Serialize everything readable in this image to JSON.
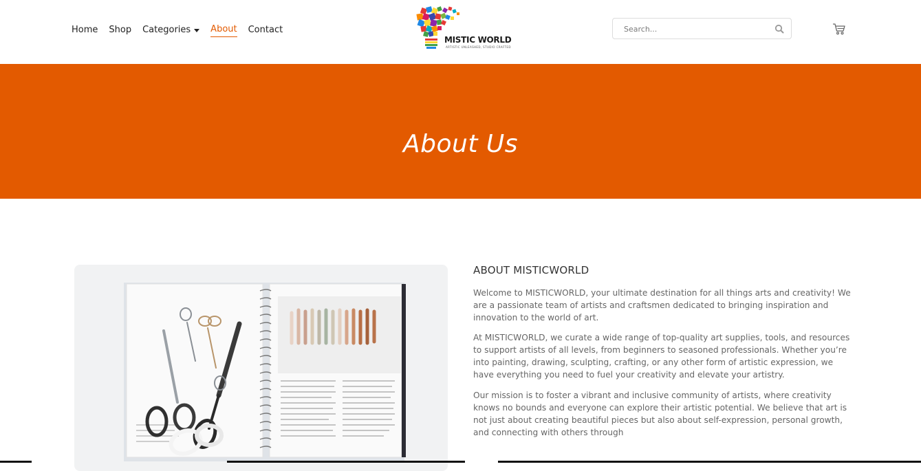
{
  "nav": {
    "items": [
      {
        "label": "Home",
        "active": false
      },
      {
        "label": "Shop",
        "active": false
      },
      {
        "label": "Categories",
        "active": false,
        "dropdown": true
      },
      {
        "label": "About",
        "active": true
      },
      {
        "label": "Contact",
        "active": false
      }
    ]
  },
  "logo": {
    "name": "MISTIC WORLD",
    "tagline": "ARTISTIC UNLEASHED, STUDIO CRAFTED"
  },
  "search": {
    "placeholder": "Search...",
    "icon": "search-icon"
  },
  "cart": {
    "icon": "cart-icon"
  },
  "banner": {
    "title": "About Us"
  },
  "about": {
    "heading": "ABOUT MISTICWORLD",
    "paragraphs": [
      "Welcome to MISTICWORLD, your ultimate destination for all things arts and creativity! We are a passionate team of artists and craftsmen dedicated to bringing inspiration and innovation to the world of art.",
      "At MISTICWORLD, we curate a wide range of top-quality art supplies, tools, and resources to support artists of all levels, from beginners to seasoned professionals. Whether you’re into painting, drawing, sculpting, crafting, or any other form of artistic expression, we have everything you need to fuel your creativity and elevate your artistry.",
      "Our mission is to foster a vibrant and inclusive community of artists, where creativity knows no bounds and everyone can explore their artistic potential. We believe that art is not just about creating beautiful pieces but also about self-expression, personal growth, and connecting with others through"
    ]
  },
  "colors": {
    "accent": "#e35a00",
    "text": "#666666",
    "heading": "#333333"
  }
}
